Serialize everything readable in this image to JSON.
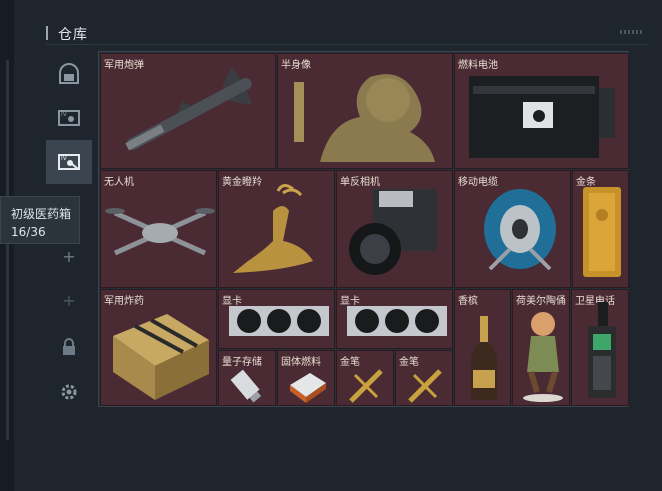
{
  "header": {
    "title": "仓库"
  },
  "tooltip": {
    "name": "初级医药箱",
    "count": "16/36"
  },
  "sidebar": {
    "items": [
      {
        "icon": "helmet-icon"
      },
      {
        "icon": "monitor-icon"
      },
      {
        "icon": "monitor-key-icon"
      },
      {
        "icon": "add-icon"
      },
      {
        "icon": "add-icon"
      },
      {
        "icon": "lock-icon"
      },
      {
        "icon": "gear-icon"
      }
    ]
  },
  "items": [
    {
      "label": "军用炮弹"
    },
    {
      "label": "半身像"
    },
    {
      "label": "燃料电池"
    },
    {
      "label": "无人机"
    },
    {
      "label": "黄金瞪羚"
    },
    {
      "label": "单反相机"
    },
    {
      "label": "移动电缆"
    },
    {
      "label": "金条"
    },
    {
      "label": "军用炸药"
    },
    {
      "label": "显卡"
    },
    {
      "label": "显卡"
    },
    {
      "label": "香槟"
    },
    {
      "label": "荷美尔陶俑"
    },
    {
      "label": "卫星电话"
    },
    {
      "label": "量子存储"
    },
    {
      "label": "固体燃料"
    },
    {
      "label": "金笔"
    },
    {
      "label": "金笔"
    }
  ]
}
